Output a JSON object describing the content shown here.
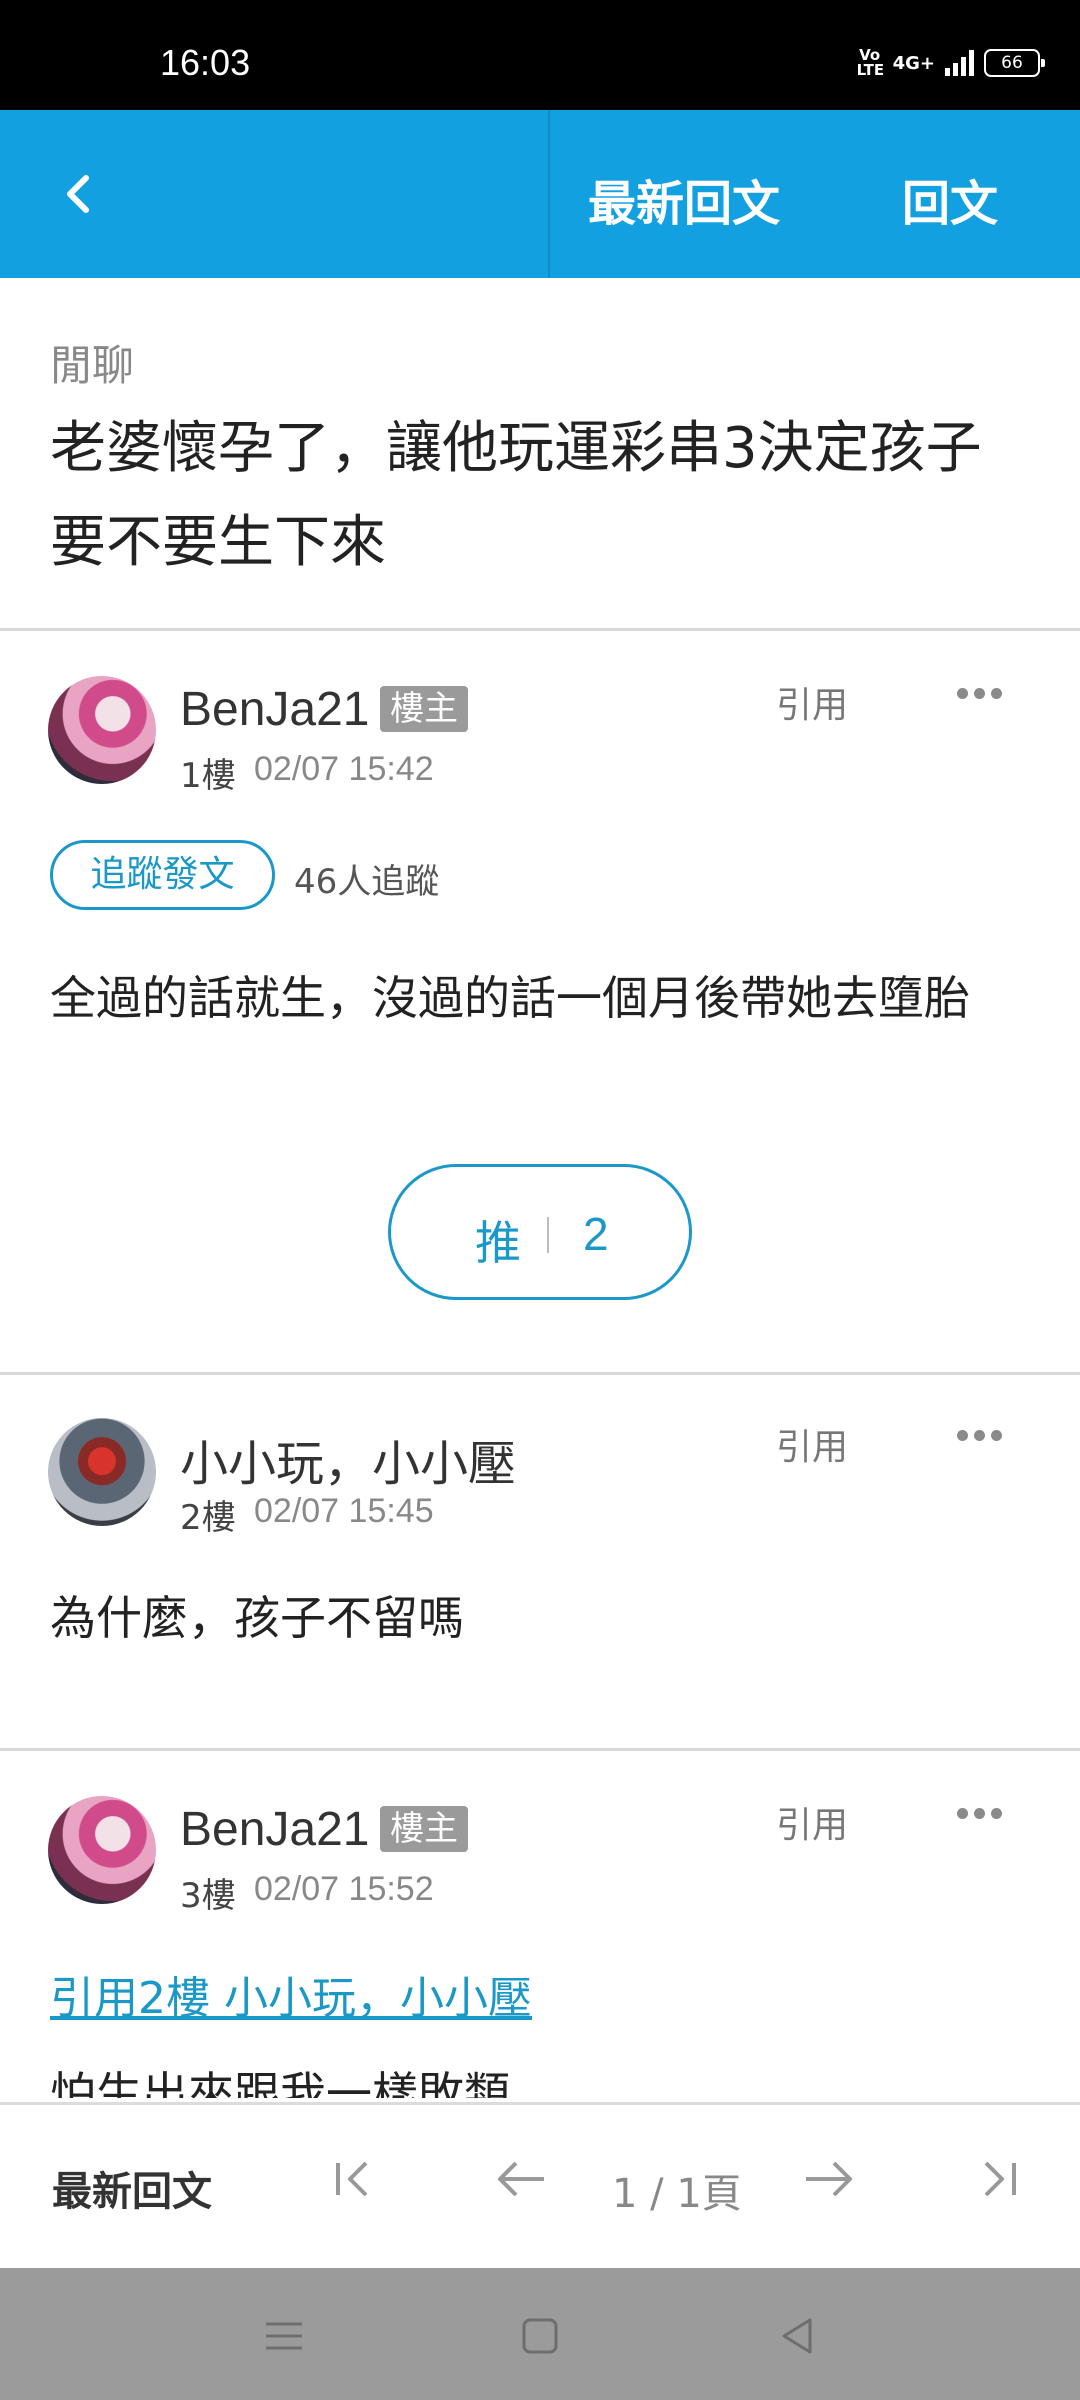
{
  "status_bar": {
    "time": "16:03",
    "volte": "Vo LTE",
    "network": "4G+",
    "battery": "66"
  },
  "header": {
    "latest_reply": "最新回文",
    "reply": "回文"
  },
  "thread": {
    "category": "閒聊",
    "title": "老婆懷孕了，讓他玩運彩串3決定孩子要不要生下來"
  },
  "posts": [
    {
      "username": "BenJa21",
      "badge": "樓主",
      "floor": "1樓",
      "date": "02/07 15:42",
      "quote_label": "引用",
      "follow_label": "追蹤發文",
      "follow_count": "46人追蹤",
      "body": "全過的話就生，沒過的話一個月後帶她去墮胎",
      "push_label": "推",
      "push_count": "2"
    },
    {
      "username": "小小玩，小小壓",
      "floor": "2樓",
      "date": "02/07 15:45",
      "quote_label": "引用",
      "body": "為什麼，孩子不留嗎"
    },
    {
      "username": "BenJa21",
      "badge": "樓主",
      "floor": "3樓",
      "date": "02/07 15:52",
      "quote_label": "引用",
      "quote_link": "引用2樓 小小玩，小小壓",
      "body": "怕生出來跟我一樣敗類"
    }
  ],
  "bottom_bar": {
    "latest_reply": "最新回文",
    "page_info": "1 / 1頁"
  }
}
